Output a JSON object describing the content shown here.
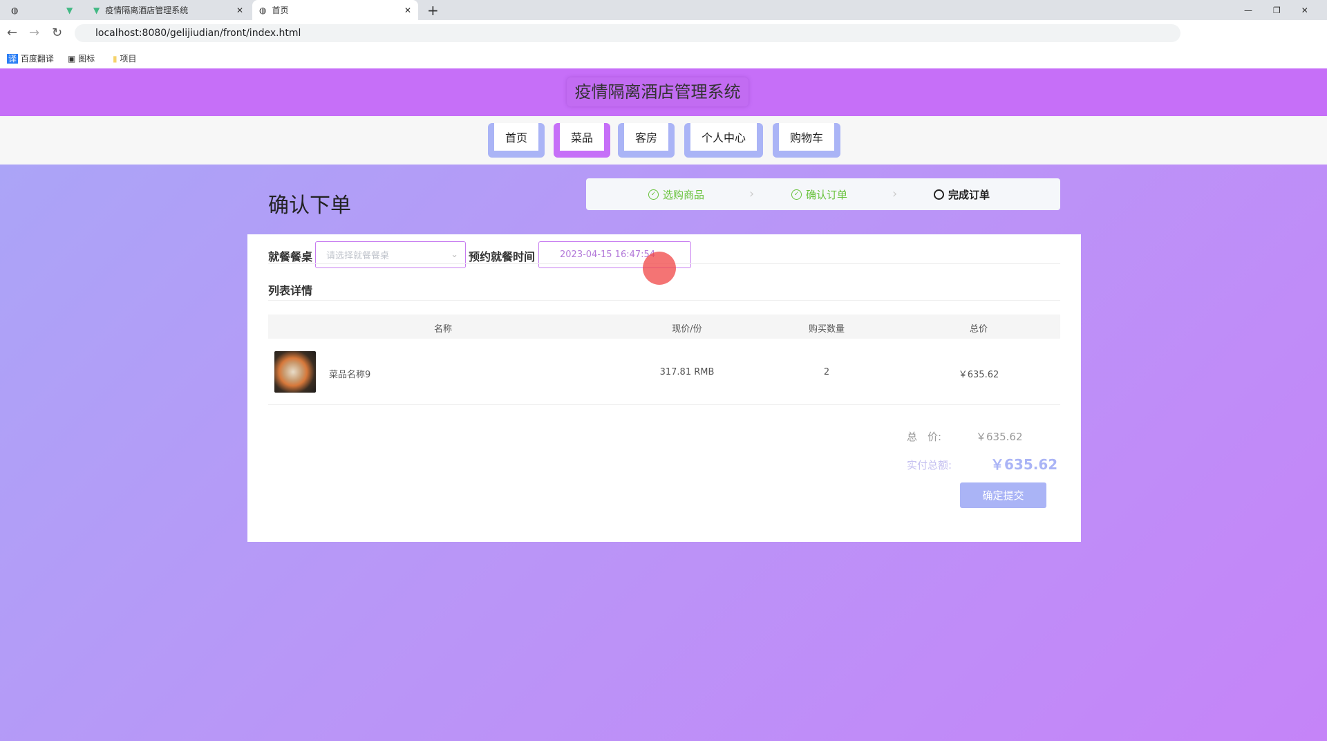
{
  "browser": {
    "tabs": [
      {
        "title": "疫情隔离酒店管理系统"
      },
      {
        "title": "首页"
      }
    ],
    "url": "localhost:8080/gelijiudian/front/index.html",
    "bookmarks": [
      "百度翻译",
      "图标",
      "项目"
    ]
  },
  "header": {
    "title": "疫情隔离酒店管理系统"
  },
  "nav": [
    "首页",
    "菜品",
    "客房",
    "个人中心",
    "购物车"
  ],
  "page": {
    "title": "确认下单",
    "steps": [
      "选购商品",
      "确认订单",
      "完成订单"
    ]
  },
  "form": {
    "table_label": "就餐餐桌",
    "table_placeholder": "请选择就餐餐桌",
    "time_label": "预约就餐时间",
    "time_value": "2023-04-15 16:47:54"
  },
  "list": {
    "title": "列表详情",
    "headers": [
      "名称",
      "现价/份",
      "购买数量",
      "总价"
    ],
    "rows": [
      {
        "name": "菜品名称9",
        "price": "317.81 RMB",
        "qty": "2",
        "total": "￥635.62"
      }
    ]
  },
  "summary": {
    "total_label": "总　价:",
    "total_value": "￥635.62",
    "pay_label": "实付总额:",
    "pay_value": "￥635.62",
    "submit": "确定提交"
  },
  "colors": {
    "header": "#c66ff8",
    "button": "#aab4f6",
    "success": "#67c23a"
  }
}
